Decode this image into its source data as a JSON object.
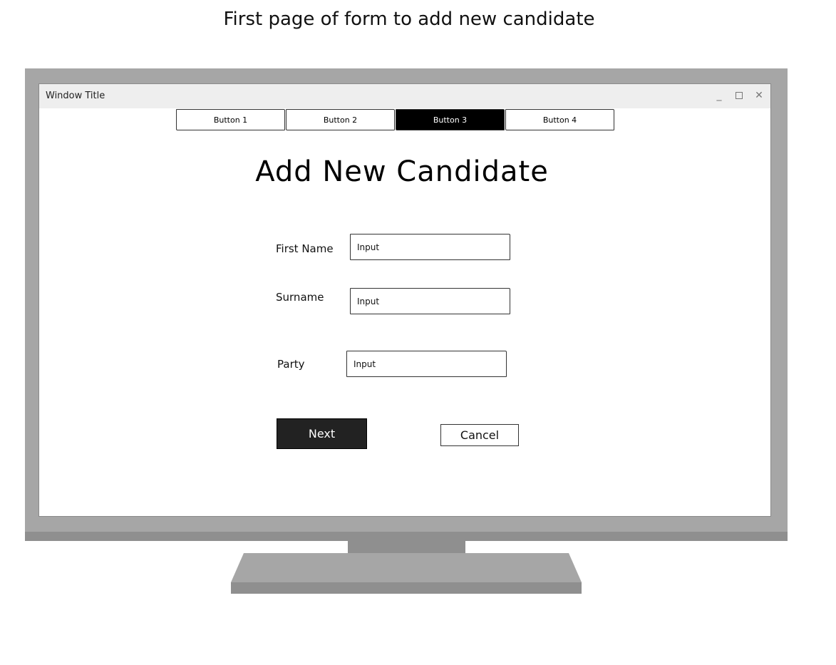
{
  "caption": "First page of form to add new candidate",
  "window": {
    "title": "Window Title",
    "controls": {
      "minimize": "_",
      "close": "✕"
    }
  },
  "buttonbar": {
    "buttons": [
      {
        "label": "Button 1",
        "active": false
      },
      {
        "label": "Button 2",
        "active": false
      },
      {
        "label": "Button 3",
        "active": true
      },
      {
        "label": "Button 4",
        "active": false
      }
    ]
  },
  "form": {
    "heading": "Add New Candidate",
    "fields": [
      {
        "label": "First Name",
        "placeholder": "Input"
      },
      {
        "label": "Surname",
        "placeholder": "Input"
      },
      {
        "label": "Party",
        "placeholder": "Input"
      }
    ],
    "next_label": "Next",
    "cancel_label": "Cancel"
  }
}
